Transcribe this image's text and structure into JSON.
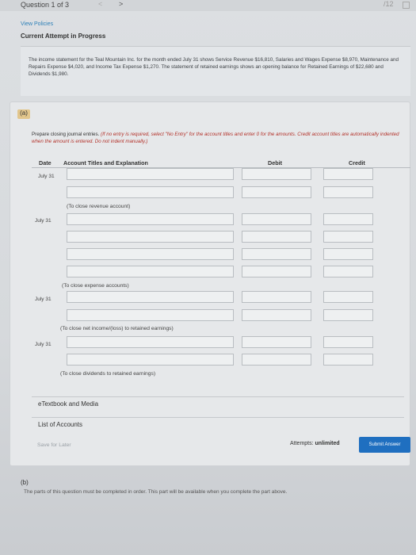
{
  "header": {
    "question_label": "Question 1 of 3",
    "nav_prev": "<",
    "nav_next": ">",
    "top_right": "/12"
  },
  "links": {
    "view_policies": "View Policies",
    "status": "Current Attempt in Progress"
  },
  "problem": {
    "text": "The income statement for the Teal Mountain Inc. for the month ended July 31 shows Service Revenue $16,810, Salaries and Wages Expense $8,970, Maintenance and Repairs Expense $4,020, and Income Tax Expense $1,270. The statement of retained earnings shows an opening balance for Retained Earnings of $22,680 and Dividends $1,980."
  },
  "part_a": {
    "label": "(a)",
    "instructions_plain": "Prepare closing journal entries.",
    "instructions_red": "(If no entry is required, select \"No Entry\" for the account titles and enter 0 for the amounts. Credit account titles are automatically indented when the amount is entered. Do not indent manually.)",
    "columns": {
      "date": "Date",
      "account": "Account Titles and Explanation",
      "debit": "Debit",
      "credit": "Credit"
    },
    "entries": [
      {
        "date": "July 31",
        "note": "(To close revenue account)"
      },
      {
        "date": "July 31",
        "note": "(To close expense accounts)"
      },
      {
        "date": "July 31",
        "note": "(To close net income/(loss) to retained earnings)"
      },
      {
        "date": "July 31",
        "note": "(To close dividends to retained earnings)"
      }
    ]
  },
  "footer": {
    "etextbook": "eTextbook and Media",
    "list_accounts": "List of Accounts",
    "save_later": "Save for Later",
    "attempts_label": "Attempts:",
    "attempts_value": "unlimited",
    "submit": "Submit Answer"
  },
  "part_b": {
    "label": "(b)",
    "text": "The parts of this question must be completed in order. This part will be available when you complete the part above."
  }
}
